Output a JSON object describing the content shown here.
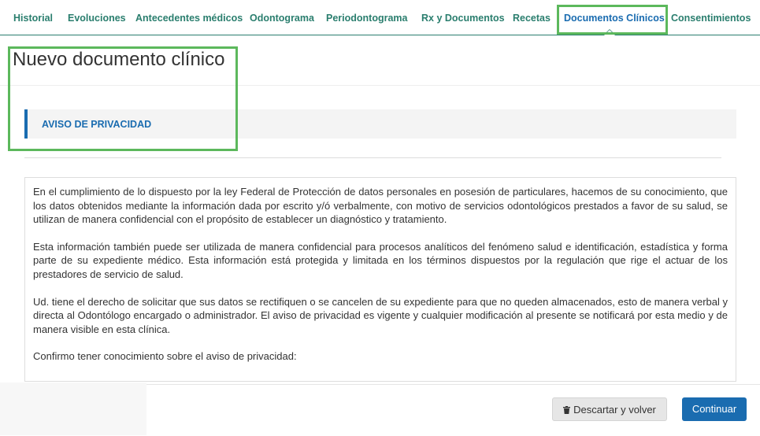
{
  "tabs": [
    {
      "label": "Historial"
    },
    {
      "label": "Evoluciones"
    },
    {
      "label": "Antecedentes médicos"
    },
    {
      "label": "Odontograma"
    },
    {
      "label": "Periodontograma"
    },
    {
      "label": "Rx y Documentos"
    },
    {
      "label": "Recetas"
    },
    {
      "label": "Documentos Clínicos"
    },
    {
      "label": "Consentimientos"
    }
  ],
  "page": {
    "title": "Nuevo documento clínico",
    "section_label": "AVISO DE PRIVACIDAD"
  },
  "document": {
    "paragraphs": [
      "En el cumplimiento de lo dispuesto por la ley Federal de Protección de datos personales en posesión de particulares, hacemos de su conocimiento, que los datos obtenidos mediante la información dada por escrito y/ó verbalmente, con motivo de servicios odontológicos prestados a favor de su salud, se utilizan de manera confidencial con el propósito de establecer un diagnóstico y tratamiento.",
      "Esta información también puede ser utilizada de manera confidencial para procesos analíticos del fenómeno salud e identificación, estadística y forma parte de su expediente médico. Esta información está protegida y limitada en los términos dispuestos por la regulación que rige el actuar de los prestadores de servicio de salud.",
      "Ud. tiene el derecho de solicitar que sus datos se rectifiquen o se cancelen de su expediente para que no queden almacenados, esto de manera verbal y directa al Odontólogo encargado o administrador. El aviso de privacidad es vigente y cualquier modificación al presente se notificará por esta medio y de manera visible en esta clínica.",
      "Confirmo tener conocimiento sobre el aviso de privacidad:"
    ]
  },
  "footer": {
    "discard_label": "Descartar y volver",
    "continue_label": "Continuar"
  },
  "colors": {
    "tab_text": "#2a7e6e",
    "active_tab": "#1a6cb0",
    "highlight": "#5cb85c",
    "primary_button": "#1a6cb0"
  }
}
